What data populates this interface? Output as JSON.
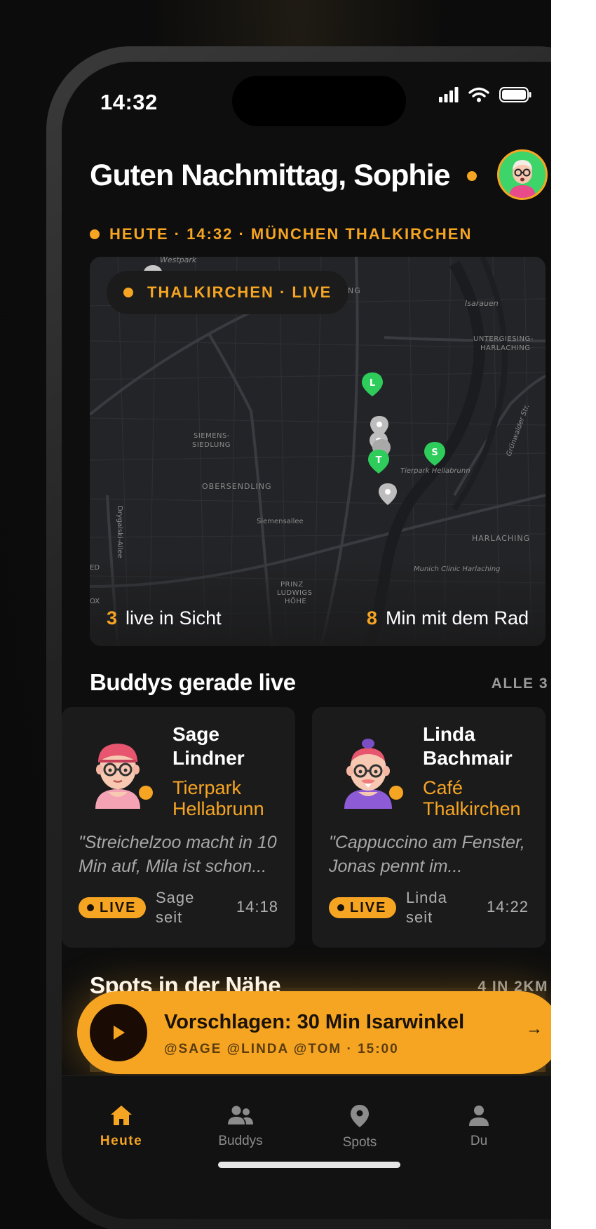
{
  "status_bar": {
    "time": "14:32"
  },
  "header": {
    "greeting": "Guten Nachmittag, Sophie"
  },
  "location": {
    "line": "HEUTE · 14:32 · MÜNCHEN THALKIRCHEN"
  },
  "map": {
    "pill": "THALKIRCHEN · LIVE",
    "labels": {
      "westpark": "Westpark",
      "sendling": "ENDLING",
      "isarauen": "Isarauen",
      "untergiesing": "UNTERGIESING-",
      "harlaching_top": "HARLACHING",
      "siemens": "SIEMENS-",
      "siedlung": "SIEDLUNG",
      "tierpark": "Tierpark Hellabrunn",
      "obersendling": "OBERSENDLING",
      "siemensallee": "Siemensallee",
      "harlaching": "HARLACHING",
      "grunwalder": "Grünwalder Str.",
      "drygalski": "Drygalski-Allee",
      "munich_clinic": "Munich Clinic Harlaching",
      "prinz": "PRINZ",
      "ludwigs": "LUDWIGS",
      "hohe": "HÖHE",
      "ed": "ED",
      "ox": "OX"
    },
    "markers": {
      "l": "L",
      "s": "S",
      "t": "T"
    },
    "stat_live_num": "3",
    "stat_live_label": "live in Sicht",
    "stat_bike_num": "8",
    "stat_bike_label": "Min mit dem Rad"
  },
  "buddies_section": {
    "title": "Buddys gerade live",
    "link": "ALLE 3"
  },
  "buddies": [
    {
      "name_line1": "Sage",
      "name_line2": "Lindner",
      "place_line1": "Tierpark",
      "place_line2": "Hellabrunn",
      "quote_line1": "\"Streichelzoo macht in 10",
      "quote_line2": "Min auf, Mila ist schon...",
      "badge": "LIVE",
      "since_line1": "Sage",
      "since_line2": "seit",
      "time": "14:18"
    },
    {
      "name_line1": "Linda",
      "name_line2": "Bachmair",
      "place_line1": "Café",
      "place_line2": "Thalkirchen",
      "quote_line1": "\"Cappuccino am Fenster,",
      "quote_line2": "Jonas pennt im...",
      "badge": "LIVE",
      "since_line1": "Linda",
      "since_line2": "seit",
      "time": "14:22"
    }
  ],
  "spots_section": {
    "title": "Spots in der Nähe",
    "link": "4 IN 2KM"
  },
  "cta": {
    "title": "Vorschlagen: 30 Min Isarwinkel",
    "subtitle": "@SAGE @LINDA @TOM · 15:00",
    "arrow": "→"
  },
  "tabs": [
    {
      "label": "Heute",
      "icon": "home-icon"
    },
    {
      "label": "Buddys",
      "icon": "people-icon"
    },
    {
      "label": "Spots",
      "icon": "pin-icon"
    },
    {
      "label": "Du",
      "icon": "person-icon"
    }
  ],
  "colors": {
    "accent": "#f6a523",
    "background": "#0e0e0e",
    "card": "#1b1b1c",
    "marker_green": "#2ecc5b"
  }
}
